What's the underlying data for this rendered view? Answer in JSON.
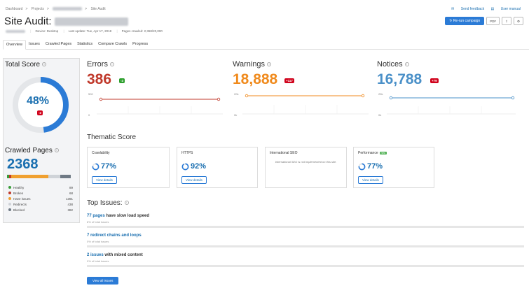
{
  "breadcrumb": {
    "dashboard": "Dashboard",
    "projects": "Projects",
    "current": "Site Audit"
  },
  "header": {
    "title": "Site Audit:",
    "device": "Device: Desktop",
    "last_update": "Last update: Tue, Apr 17, 2018",
    "pages_crawled": "Pages crawled: 2,368/20,000",
    "send_feedback": "Send feedback",
    "user_manual": "User manual",
    "rerun_label": "Re-run campaign",
    "pdf_label": "PDF"
  },
  "tabs": [
    {
      "label": "Overview"
    },
    {
      "label": "Issues"
    },
    {
      "label": "Crawled Pages"
    },
    {
      "label": "Statistics"
    },
    {
      "label": "Compare Crawls"
    },
    {
      "label": "Progress"
    }
  ],
  "total_score": {
    "title": "Total Score",
    "value": "48%",
    "fraction": 0.48,
    "delta": "-2"
  },
  "crawled_pages": {
    "title": "Crawled Pages",
    "count": "2368",
    "legend": [
      {
        "label": "Healthy",
        "value": "89",
        "color": "#3a9d3a"
      },
      {
        "label": "Broken",
        "value": "68",
        "color": "#c0392b"
      },
      {
        "label": "Have issues",
        "value": "1391",
        "color": "#f0a030"
      },
      {
        "label": "Redirects",
        "value": "438",
        "color": "#cfd3d8"
      },
      {
        "label": "Blocked",
        "value": "382",
        "color": "#6f7a85"
      }
    ]
  },
  "metrics": {
    "errors": {
      "title": "Errors",
      "value": "386",
      "delta": "-3",
      "ymax": "500",
      "ymin": "0",
      "color": "#c0392b"
    },
    "warnings": {
      "title": "Warnings",
      "value": "18,888",
      "delta": "+117",
      "ymax": "20k",
      "ymin": "0k",
      "color": "#f08a1c"
    },
    "notices": {
      "title": "Notices",
      "value": "16,788",
      "delta": "+79",
      "ymax": "25k",
      "ymin": "0k",
      "color": "#4a90c8"
    }
  },
  "thematic": {
    "title": "Thematic Score",
    "cards": [
      {
        "title": "Crawlability",
        "pct": "77%",
        "fraction": 0.77,
        "button": "View details"
      },
      {
        "title": "HTTPS",
        "pct": "92%",
        "fraction": 0.92,
        "button": "View details"
      },
      {
        "title": "International SEO",
        "note": "International SEO is not implemented on this site."
      },
      {
        "title": "Performance",
        "badge": "new",
        "pct": "77%",
        "fraction": 0.77,
        "button": "View details"
      }
    ]
  },
  "top_issues": {
    "title": "Top Issues:",
    "items": [
      {
        "link": "77 pages",
        "rest": " have slow load speed",
        "sub": "8% of total issues"
      },
      {
        "link": "7 redirect chains and loops",
        "rest": "",
        "sub": "0% of total issues"
      },
      {
        "link": "2 issues",
        "rest": " with mixed content",
        "sub": "0% of total issues"
      }
    ],
    "view_all": "View all issues"
  }
}
